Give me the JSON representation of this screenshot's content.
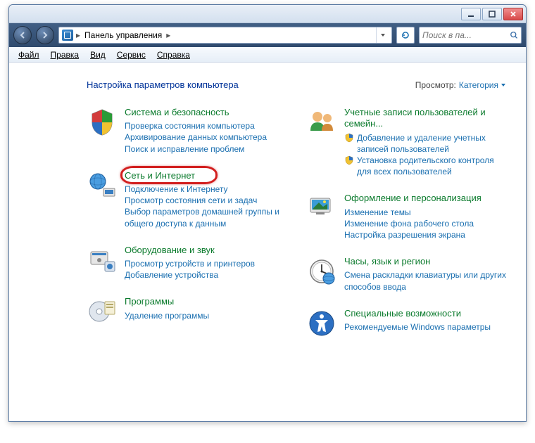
{
  "breadcrumb": {
    "root": "Панель управления"
  },
  "search": {
    "placeholder": "Поиск в па..."
  },
  "menu": {
    "file": "Файл",
    "edit": "Правка",
    "view": "Вид",
    "tools": "Сервис",
    "help": "Справка"
  },
  "header": {
    "title": "Настройка параметров компьютера",
    "view_label": "Просмотр:",
    "view_mode": "Категория"
  },
  "left": [
    {
      "title": "Система и безопасность",
      "subs": [
        "Проверка состояния компьютера",
        "Архивирование данных компьютера",
        "Поиск и исправление проблем"
      ]
    },
    {
      "title": "Сеть и Интернет",
      "highlighted": true,
      "subs": [
        "Подключение к Интернету",
        "Просмотр состояния сети и задач",
        "Выбор параметров домашней группы и общего доступа к данным"
      ]
    },
    {
      "title": "Оборудование и звук",
      "subs": [
        "Просмотр устройств и принтеров",
        "Добавление устройства"
      ]
    },
    {
      "title": "Программы",
      "subs": [
        "Удаление программы"
      ]
    }
  ],
  "right": [
    {
      "title": "Учетные записи пользователей и семейн...",
      "subs_shield": [
        "Добавление и удаление учетных записей пользователей",
        "Установка родительского контроля для всех пользователей"
      ]
    },
    {
      "title": "Оформление и персонализация",
      "subs": [
        "Изменение темы",
        "Изменение фона рабочего стола",
        "Настройка разрешения экрана"
      ]
    },
    {
      "title": "Часы, язык и регион",
      "subs": [
        "Смена раскладки клавиатуры или других способов ввода"
      ]
    },
    {
      "title": "Специальные возможности",
      "subs": [
        "Рекомендуемые Windows параметры"
      ]
    }
  ]
}
